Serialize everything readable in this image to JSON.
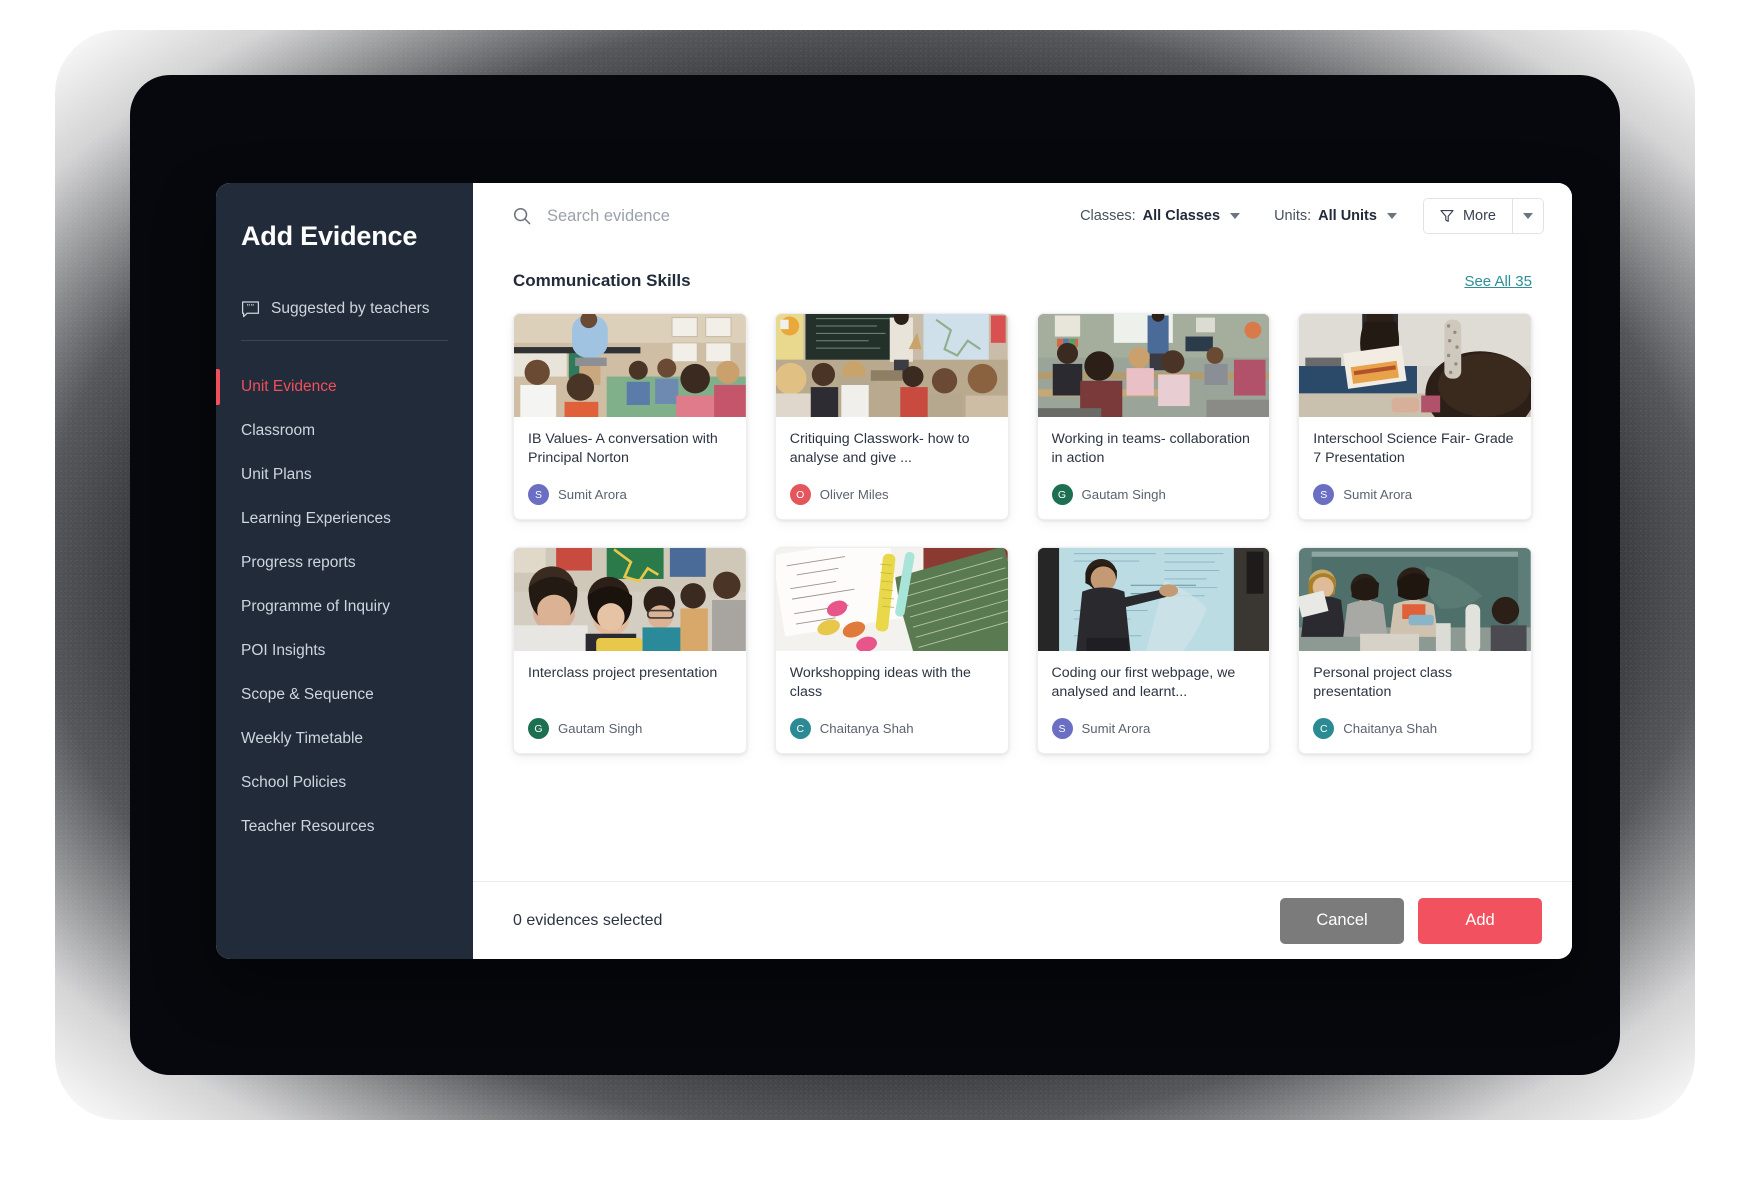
{
  "sidebar": {
    "title": "Add Evidence",
    "suggested": {
      "label": "Suggested by teachers",
      "icon": "quote-bubble-icon"
    },
    "items": [
      {
        "label": "Unit Evidence",
        "active": true
      },
      {
        "label": "Classroom",
        "active": false
      },
      {
        "label": "Unit Plans",
        "active": false
      },
      {
        "label": "Learning Experiences",
        "active": false
      },
      {
        "label": "Progress reports",
        "active": false
      },
      {
        "label": "Programme of Inquiry",
        "active": false
      },
      {
        "label": "POI Insights",
        "active": false
      },
      {
        "label": "Scope & Sequence",
        "active": false
      },
      {
        "label": "Weekly Timetable",
        "active": false
      },
      {
        "label": "School Policies",
        "active": false
      },
      {
        "label": "Teacher Resources",
        "active": false
      }
    ],
    "active_accent": "#f04f5c",
    "background": "#222b3a"
  },
  "topbar": {
    "search": {
      "placeholder": "Search evidence",
      "value": "",
      "icon": "search-icon"
    },
    "classes_filter": {
      "label": "Classes:",
      "value": "All Classes",
      "icon": "chevron-down-icon"
    },
    "units_filter": {
      "label": "Units:",
      "value": "All Units",
      "icon": "chevron-down-icon"
    },
    "more_button": {
      "label": "More",
      "icon": "filter-funnel-icon"
    },
    "more_split": {
      "icon": "chevron-down-icon"
    }
  },
  "section": {
    "title": "Communication Skills",
    "see_all": "See All 35"
  },
  "cards": [
    {
      "title": "IB Values- A conversation with Principal Norton",
      "author": "Sumit Arora",
      "initial": "S",
      "avatar_color": "#6a6fc4",
      "thumb": "teacher-seated-with-students-circle"
    },
    {
      "title": "Critiquing Classwork- how to analyse and give ...",
      "author": "Oliver Miles",
      "initial": "O",
      "avatar_color": "#e4555c",
      "thumb": "teacher-at-blackboard-raised-hands"
    },
    {
      "title": "Working in teams- collaboration in action",
      "author": "Gautam Singh",
      "initial": "G",
      "avatar_color": "#1d6f52",
      "thumb": "classroom-rows-students-teacher-front"
    },
    {
      "title": "Interschool Science Fair- Grade 7 Presentation",
      "author": "Sumit Arora",
      "initial": "S",
      "avatar_color": "#6a6fc4",
      "thumb": "student-holding-poster-presentation"
    },
    {
      "title": "Interclass project presentation",
      "author": "Gautam Singh",
      "initial": "G",
      "avatar_color": "#1d6f52",
      "thumb": "smiling-students-group-photo"
    },
    {
      "title": "Workshopping ideas with the class",
      "author": "Chaitanya Shah",
      "initial": "C",
      "avatar_color": "#2b8a93",
      "thumb": "desk-notebook-crayons-flatlay"
    },
    {
      "title": "Coding our first webpage, we analysed and learnt...",
      "author": "Sumit Arora",
      "initial": "S",
      "avatar_color": "#6a6fc4",
      "thumb": "man-pointing-at-projector-screen"
    },
    {
      "title": "Personal project class presentation",
      "author": "Chaitanya Shah",
      "initial": "C",
      "avatar_color": "#2b8a93",
      "thumb": "students-at-green-chalkboard-reading"
    }
  ],
  "footer": {
    "selected_count": "0 evidences selected",
    "cancel_label": "Cancel",
    "add_label": "Add",
    "add_color": "#f2525f",
    "cancel_color": "#7b7b7b"
  }
}
